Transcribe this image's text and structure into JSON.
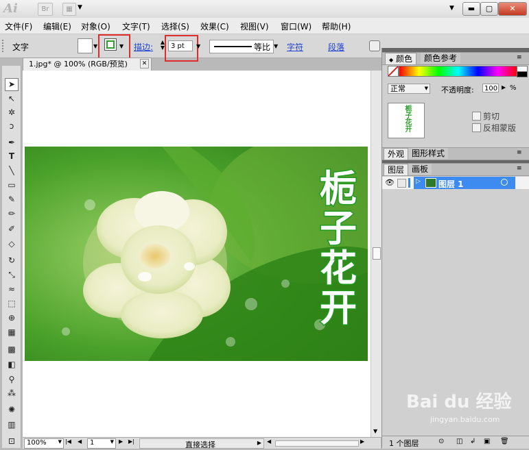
{
  "window": {
    "app_logo": "Ai",
    "bridge_label": "Br",
    "arrange_label": "▼",
    "min_label": "▬",
    "max_label": "▢",
    "close_label": "✕",
    "collapse_label": "▼"
  },
  "menu": [
    "文件(F)",
    "编辑(E)",
    "对象(O)",
    "文字(T)",
    "选择(S)",
    "效果(C)",
    "视图(V)",
    "窗口(W)",
    "帮助(H)"
  ],
  "control_bar": {
    "type_label": "文字",
    "stroke_label": "描边:",
    "stroke_weight": "3 pt",
    "stroke_profile": "等比",
    "char_link": "字符",
    "para_link": "段落"
  },
  "document_tab": {
    "title": "1.jpg* @ 100% (RGB/预览)",
    "close": "✕"
  },
  "artwork": {
    "text_chars": [
      "栀",
      "子",
      "花",
      "开"
    ]
  },
  "status_bar": {
    "zoom": "100%",
    "page": "1",
    "tool_status": "直接选择"
  },
  "panels": {
    "color_tab": "颜色",
    "color_guide_tab": "颜色参考",
    "blend_mode": "正常",
    "opacity_label": "不透明度:",
    "opacity_value": "100",
    "opacity_unit": "%",
    "thumb_text": "栀子花开",
    "clip_label": "剪切",
    "invert_mask_label": "反相蒙版",
    "appearance_tab": "外观",
    "graphic_styles_tab": "图形样式",
    "layers_tab": "图层",
    "artboards_tab": "画板",
    "layer_name": "图层 1",
    "layer_count": "1 个图层"
  },
  "watermark": {
    "brand": "Bai du 经验",
    "url": "jingyan.baidu.com"
  },
  "colors": {
    "fill_stroke_green": "#2f9e2f",
    "layer_selected": "#3d8af0",
    "text_fill": "#ffffff",
    "text_stroke": "#1e9a1e"
  }
}
